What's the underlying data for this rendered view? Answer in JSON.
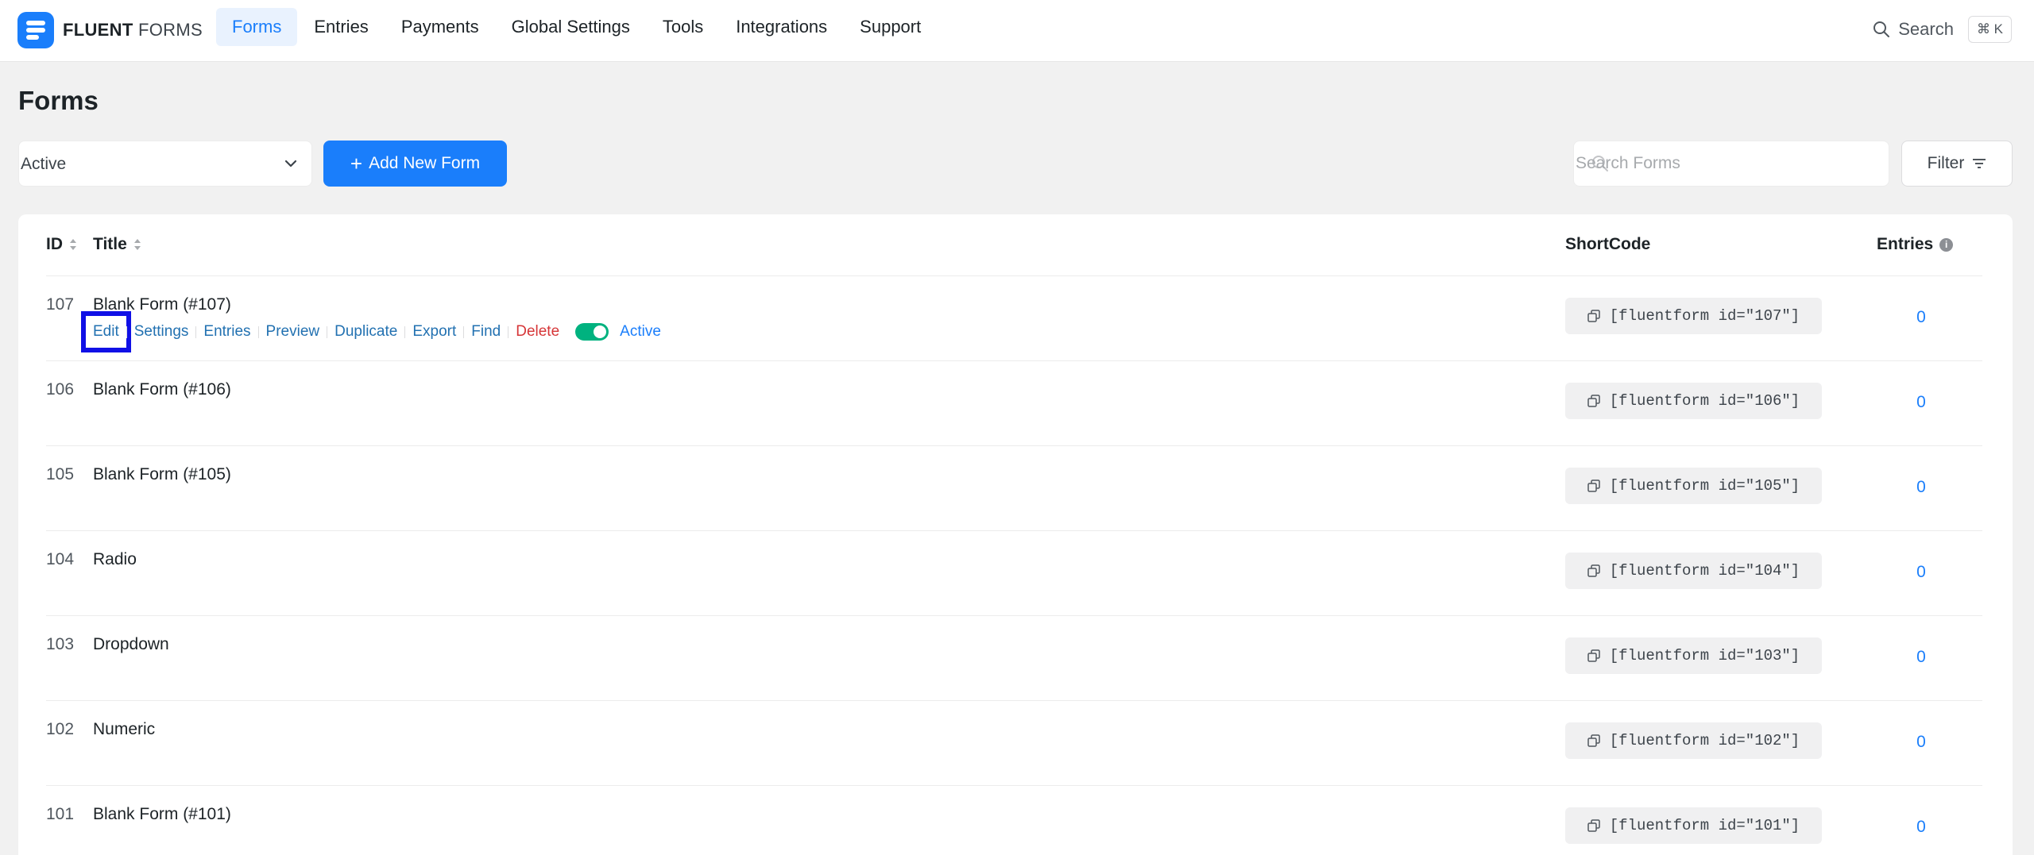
{
  "brand": {
    "name_bold": "FLUENT",
    "name_light": "FORMS"
  },
  "nav": {
    "items": [
      {
        "label": "Forms",
        "active": true
      },
      {
        "label": "Entries"
      },
      {
        "label": "Payments"
      },
      {
        "label": "Global Settings"
      },
      {
        "label": "Tools"
      },
      {
        "label": "Integrations"
      },
      {
        "label": "Support"
      }
    ],
    "search_label": "Search",
    "search_shortcut": "⌘ K"
  },
  "page": {
    "title": "Forms"
  },
  "toolbar": {
    "status_value": "Active",
    "add_button": "Add New Form",
    "search_placeholder": "Search Forms",
    "filter_label": "Filter"
  },
  "table": {
    "columns": {
      "id": "ID",
      "title": "Title",
      "shortcode": "ShortCode",
      "entries": "Entries"
    },
    "row_actions": [
      "Edit",
      "Settings",
      "Entries",
      "Preview",
      "Duplicate",
      "Export",
      "Find",
      "Delete"
    ],
    "row_status": "Active",
    "rows": [
      {
        "id": "107",
        "title": "Blank Form (#107)",
        "shortcode": "[fluentform id=\"107\"]",
        "entries": "0"
      },
      {
        "id": "106",
        "title": "Blank Form (#106)",
        "shortcode": "[fluentform id=\"106\"]",
        "entries": "0"
      },
      {
        "id": "105",
        "title": "Blank Form (#105)",
        "shortcode": "[fluentform id=\"105\"]",
        "entries": "0"
      },
      {
        "id": "104",
        "title": "Radio",
        "shortcode": "[fluentform id=\"104\"]",
        "entries": "0"
      },
      {
        "id": "103",
        "title": "Dropdown",
        "shortcode": "[fluentform id=\"103\"]",
        "entries": "0"
      },
      {
        "id": "102",
        "title": "Numeric",
        "shortcode": "[fluentform id=\"102\"]",
        "entries": "0"
      },
      {
        "id": "101",
        "title": "Blank Form (#101)",
        "shortcode": "[fluentform id=\"101\"]",
        "entries": "0"
      }
    ]
  },
  "colors": {
    "accent": "#1a7efb",
    "delete": "#d63638",
    "toggle_on": "#00b27f",
    "highlight": "#1010e6"
  }
}
